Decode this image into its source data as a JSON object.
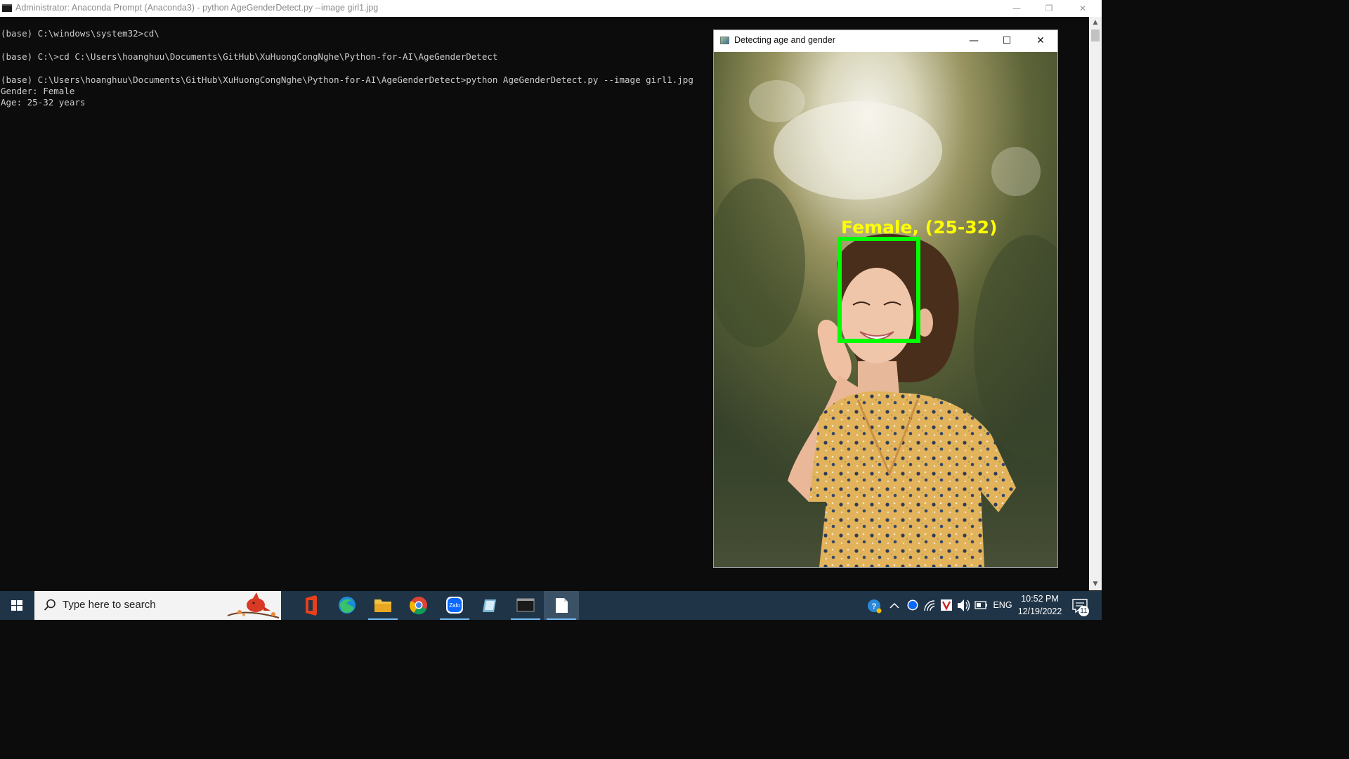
{
  "console_window": {
    "title": "Administrator: Anaconda Prompt (Anaconda3) - python  AgeGenderDetect.py --image girl1.jpg",
    "controls": {
      "minimize": "—",
      "restore": "❐",
      "close": "✕"
    },
    "lines": [
      "(base) C:\\windows\\system32>cd\\",
      "",
      "(base) C:\\>cd C:\\Users\\hoanghuu\\Documents\\GitHub\\XuHuongCongNghe\\Python-for-AI\\AgeGenderDetect",
      "",
      "(base) C:\\Users\\hoanghuu\\Documents\\GitHub\\XuHuongCongNghe\\Python-for-AI\\AgeGenderDetect>python AgeGenderDetect.py --image girl1.jpg",
      "Gender: Female",
      "Age: 25-32 years"
    ]
  },
  "scrollbar": {
    "up": "▲",
    "down": "▼"
  },
  "image_window": {
    "title": "Detecting age and gender",
    "controls": {
      "minimize": "—",
      "maximize": "☐",
      "close": "✕"
    },
    "overlay_label": "Female, (25-32)",
    "face_box_color": "#00ff00",
    "label_color": "#ffff00"
  },
  "taskbar": {
    "search_placeholder": "Type here to search",
    "apps": [
      "office-icon",
      "edge-icon",
      "file-explorer-icon",
      "chrome-icon",
      "zalo-icon",
      "notes-icon",
      "terminal-icon",
      "document-icon"
    ],
    "zalo_label": "Zalo",
    "tray": {
      "language": "ENG",
      "time": "10:52 PM",
      "date": "12/19/2022",
      "notification_count": "11"
    },
    "accent": "#1f3447"
  }
}
